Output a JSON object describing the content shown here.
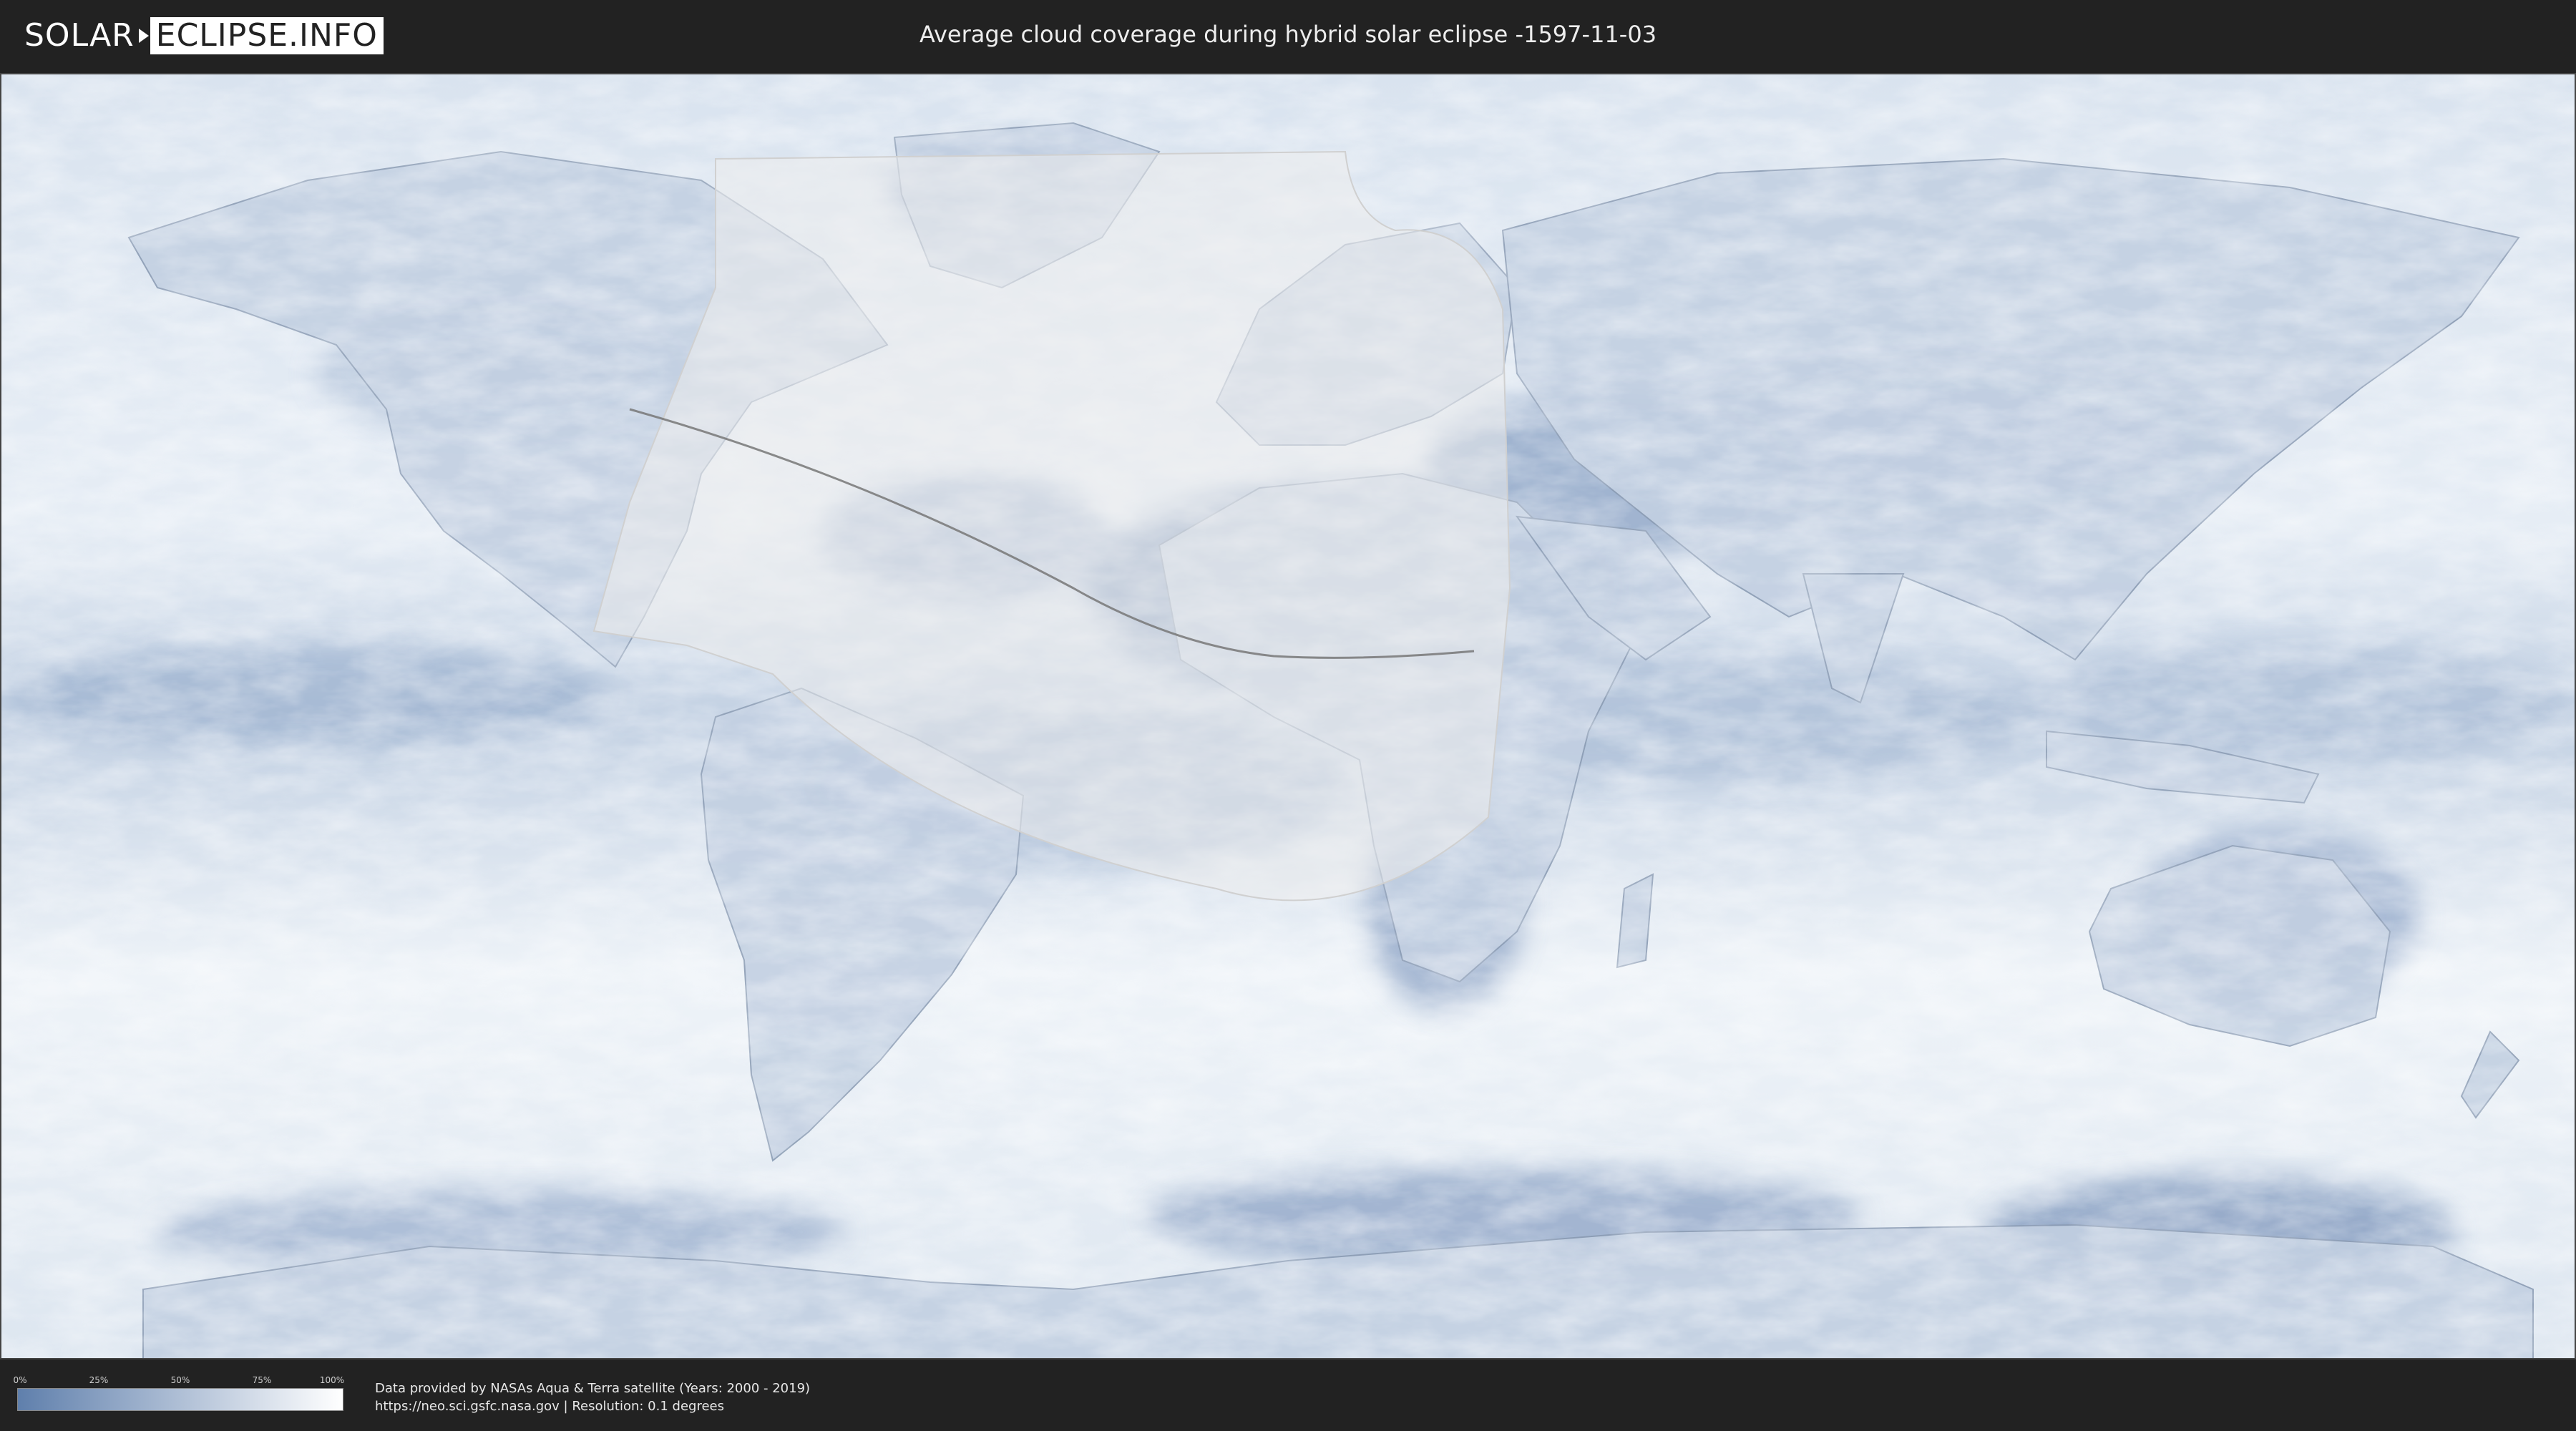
{
  "header": {
    "logo_left": "SOLAR",
    "logo_right": "ECLIPSE.INFO",
    "title": "Average cloud coverage during hybrid solar eclipse -1597-11-03"
  },
  "map": {
    "projection": "equirectangular",
    "layers": [
      "average cloud coverage",
      "country borders",
      "eclipse visibility zone",
      "eclipse central path"
    ],
    "colors": {
      "clear_sky": "#5f7fac",
      "full_cloud": "#ffffff",
      "visibility_zone": "#ececec",
      "central_path": "#7a7a7a"
    }
  },
  "legend": {
    "ticks": [
      "0%",
      "25%",
      "50%",
      "75%",
      "100%"
    ],
    "gradient_from": "#5f7fac",
    "gradient_to": "#ffffff"
  },
  "footer": {
    "credit_line1": "Data provided by NASAs Aqua & Terra satellite (Years: 2000 - 2019)",
    "credit_line2": "https://neo.sci.gsfc.nasa.gov | Resolution: 0.1 degrees"
  }
}
